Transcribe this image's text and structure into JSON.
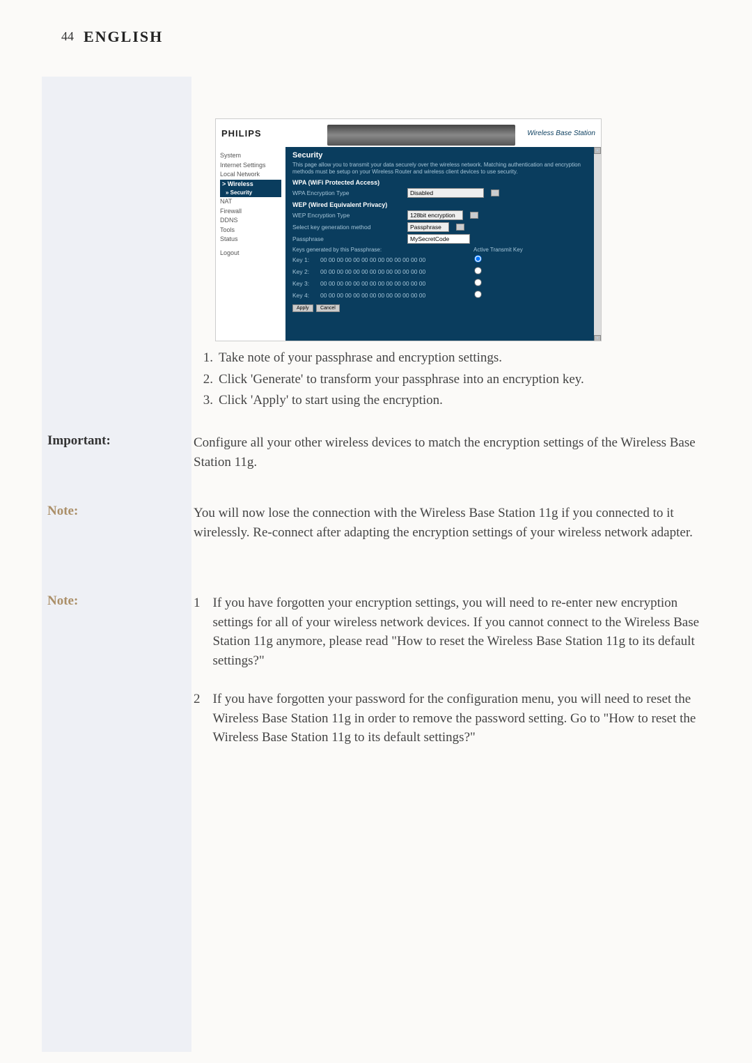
{
  "page": {
    "number": "44",
    "title": "ENGLISH"
  },
  "screenshot": {
    "brand": "PHILIPS",
    "product_tag": "Wireless Base Station",
    "nav": {
      "system": "System",
      "internet": "Internet Settings",
      "local": "Local Network",
      "wireless": "> Wireless",
      "security": "» Security",
      "nat": "NAT",
      "firewall": "Firewall",
      "ddns": "DDNS",
      "tools": "Tools",
      "status": "Status",
      "logout": "Logout"
    },
    "security": {
      "title": "Security",
      "description": "This page allow you to transmit your data securely over the wireless network. Matching authentication and encryption methods must be setup on your Wireless Router and wireless client devices to use security.",
      "wpa_heading": "WPA (WiFi Protected Access)",
      "wpa_label": "WPA Encryption Type",
      "wpa_value": "Disabled",
      "wep_heading": "WEP (Wired Equivalent Privacy)",
      "wep_label": "WEP Encryption Type",
      "wep_value": "128bit encryption",
      "keygen_label": "Select key generation method",
      "keygen_value": "Passphrase",
      "passphrase_label": "Passphrase",
      "passphrase_value": "MySecretCode",
      "keys_header_left": "Keys generated by this Passphrase:",
      "keys_header_right": "Active Transmit Key",
      "keys": [
        {
          "name": "Key 1:",
          "value": "00 00 00 00 00 00 00 00 00 00 00 00 00",
          "active": true
        },
        {
          "name": "Key 2:",
          "value": "00 00 00 00 00 00 00 00 00 00 00 00 00",
          "active": false
        },
        {
          "name": "Key 3:",
          "value": "00 00 00 00 00 00 00 00 00 00 00 00 00",
          "active": false
        },
        {
          "name": "Key 4:",
          "value": "00 00 00 00 00 00 00 00 00 00 00 00 00",
          "active": false
        }
      ],
      "apply": "Apply",
      "cancel": "Cancel"
    }
  },
  "instructions": {
    "step1": "Take note of your passphrase and encryption settings.",
    "step2": "Click 'Generate' to transform your passphrase into an encryption key.",
    "step3": "Click 'Apply' to start using the encryption."
  },
  "labels": {
    "important": "Important:",
    "note": "Note:"
  },
  "important_text": "Configure all your other wireless devices to match the encryption settings of the Wireless Base Station 11g.",
  "note1_text": "You will now lose the connection with the Wireless Base Station 11g if you connected to it wirelessly. Re-connect after adapting the encryption settings of your wireless network adapter.",
  "note2": {
    "item1": "If you have forgotten your encryption settings, you will need to re-enter new encryption settings for all of your wireless network devices. If you cannot connect to the Wireless Base Station 11g anymore, please read \"How to reset the Wireless Base Station 11g to its default settings?\"",
    "item2": "If you have forgotten your password for the configuration menu, you will need to reset the Wireless Base Station 11g in order to remove the password setting. Go to \"How to reset the Wireless Base Station 11g to its default settings?\""
  }
}
